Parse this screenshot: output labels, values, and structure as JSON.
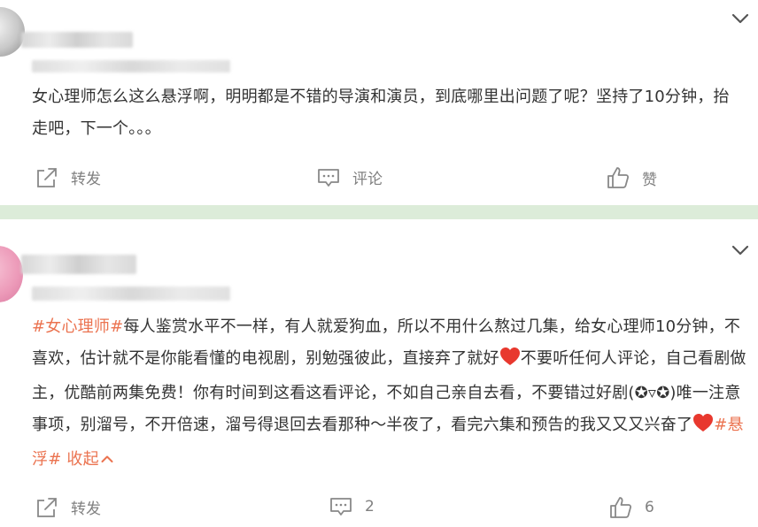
{
  "post1": {
    "content": "女心理师怎么这么悬浮啊，明明都是不错的导演和演员，到底哪里出问题了呢？坚持了10分钟，抬走吧，下一个。。。",
    "actions": {
      "repost": "转发",
      "comment": "评论",
      "like": "赞"
    }
  },
  "post2": {
    "content": {
      "tag1": "#女心理师#",
      "text1": "每人鉴赏水平不一样，有人就爱狗血，所以不用什么熬过几集，给女心理师10分钟，不喜欢，估计就不是你能看懂的电视剧，别勉强彼此，直接弃了就好",
      "text2": "不要听任何人评论，自己看剧做主，优酷前两集免费！你有时间到这看这看评论，不如自己亲自去看，不要错过好剧(✪▿✪)唯一注意事项，别溜号，不开倍速，溜号得退回去看那种～半夜了，看完六集和预告的我又又又兴奋了",
      "tag2": "#悬浮#",
      "collapse": "收起"
    },
    "actions": {
      "repost": "转发",
      "comment_count": "2",
      "like_count": "6"
    }
  },
  "colors": {
    "accent": "#eb7350",
    "divider": "#dcecd9",
    "text": "#333333",
    "muted": "#808080",
    "heart": "#e8382e"
  },
  "icons": [
    "chevron-down-icon",
    "share-icon",
    "comment-icon",
    "thumbs-up-icon",
    "heart-icon",
    "chevron-up-icon"
  ]
}
